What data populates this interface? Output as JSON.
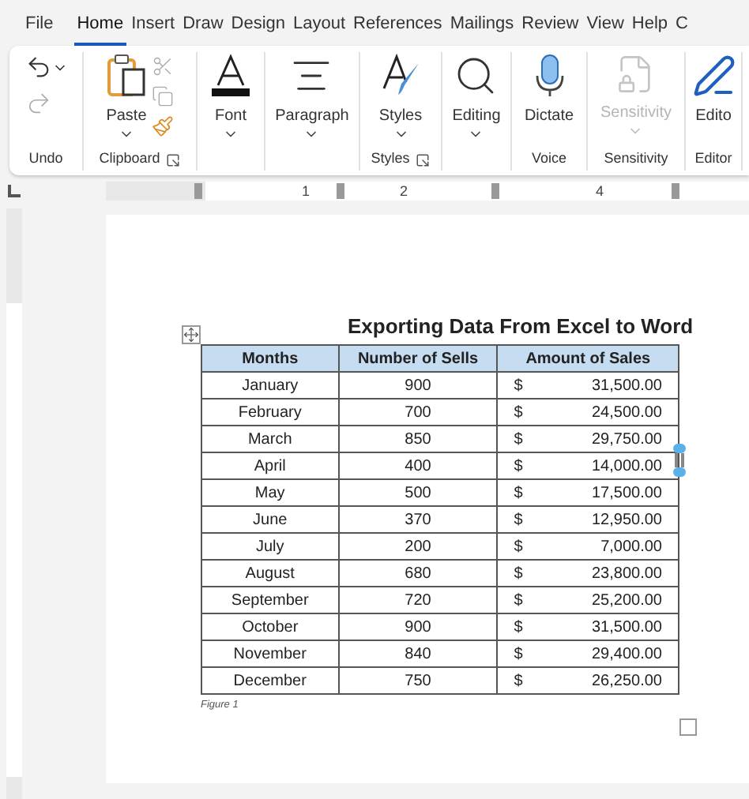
{
  "tabs": [
    {
      "label": "File",
      "selected": false
    },
    {
      "label": "Home",
      "selected": true
    },
    {
      "label": "Insert",
      "selected": false
    },
    {
      "label": "Draw",
      "selected": false
    },
    {
      "label": "Design",
      "selected": false
    },
    {
      "label": "Layout",
      "selected": false
    },
    {
      "label": "References",
      "selected": false
    },
    {
      "label": "Mailings",
      "selected": false
    },
    {
      "label": "Review",
      "selected": false
    },
    {
      "label": "View",
      "selected": false
    },
    {
      "label": "Help",
      "selected": false
    },
    {
      "label": "C",
      "selected": false
    }
  ],
  "ribbon": {
    "groups": [
      {
        "label": "Undo",
        "launcher": false
      },
      {
        "label": "Clipboard",
        "launcher": true,
        "buttons": [
          {
            "label": "Paste",
            "dropdown": true,
            "disabled": false
          }
        ]
      },
      {
        "buttons": [
          {
            "label": "Font",
            "dropdown": true,
            "disabled": false
          }
        ],
        "launcher": false
      },
      {
        "buttons": [
          {
            "label": "Paragraph",
            "dropdown": true,
            "disabled": false
          }
        ],
        "launcher": false
      },
      {
        "label": "Styles",
        "launcher": true,
        "buttons": [
          {
            "label": "Styles",
            "dropdown": true,
            "disabled": false
          }
        ]
      },
      {
        "buttons": [
          {
            "label": "Editing",
            "dropdown": true,
            "disabled": false
          }
        ],
        "launcher": false
      },
      {
        "label": "Voice",
        "launcher": false,
        "buttons": [
          {
            "label": "Dictate",
            "dropdown": false,
            "disabled": false
          }
        ]
      },
      {
        "label": "Sensitivity",
        "launcher": false,
        "buttons": [
          {
            "label": "Sensitivity",
            "dropdown": true,
            "disabled": true
          }
        ]
      },
      {
        "label": "Editor",
        "launcher": false,
        "buttons": [
          {
            "label": "Edito",
            "dropdown": false,
            "disabled": false
          }
        ]
      }
    ]
  },
  "ruler_labels": [
    "1",
    "2",
    "4"
  ],
  "document": {
    "title": "Exporting Data From Excel to Word",
    "columns": [
      "Months",
      "Number of Sells",
      "Amount of Sales"
    ],
    "rows": [
      {
        "month": "January",
        "sells": "900",
        "currency": "$",
        "amount": "31,500.00"
      },
      {
        "month": "February",
        "sells": "700",
        "currency": "$",
        "amount": "24,500.00"
      },
      {
        "month": "March",
        "sells": "850",
        "currency": "$",
        "amount": "29,750.00"
      },
      {
        "month": "April",
        "sells": "400",
        "currency": "$",
        "amount": "14,000.00"
      },
      {
        "month": "May",
        "sells": "500",
        "currency": "$",
        "amount": "17,500.00"
      },
      {
        "month": "June",
        "sells": "370",
        "currency": "$",
        "amount": "12,950.00"
      },
      {
        "month": "July",
        "sells": "200",
        "currency": "$",
        "amount": "7,000.00"
      },
      {
        "month": "August",
        "sells": "680",
        "currency": "$",
        "amount": "23,800.00"
      },
      {
        "month": "September",
        "sells": "720",
        "currency": "$",
        "amount": "25,200.00"
      },
      {
        "month": "October",
        "sells": "900",
        "currency": "$",
        "amount": "31,500.00"
      },
      {
        "month": "November",
        "sells": "840",
        "currency": "$",
        "amount": "29,400.00"
      },
      {
        "month": "December",
        "sells": "750",
        "currency": "$",
        "amount": "26,250.00"
      }
    ],
    "caption": "Figure 1"
  }
}
